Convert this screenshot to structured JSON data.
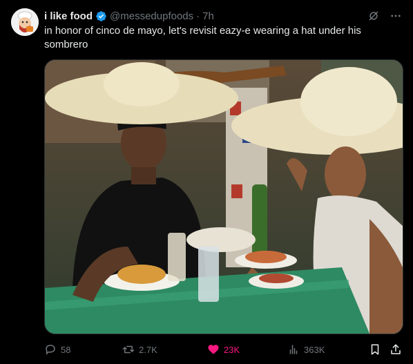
{
  "tweet": {
    "display_name": "i like food",
    "handle": "@messedupfoods",
    "separator": "·",
    "timestamp": "7h",
    "text": "in honor of cinco de mayo, let's revisit eazy-e wearing a hat under his sombrero",
    "verified": true,
    "media": {
      "type": "photo",
      "alt": ""
    }
  },
  "actions": {
    "replies": "58",
    "reposts": "2.7K",
    "likes": "23K",
    "views": "363K"
  },
  "colors": {
    "background": "#000000",
    "text": "#e7e9ea",
    "muted": "#71767b",
    "verified": "#1d9bf0",
    "like": "#f91880"
  },
  "icons": [
    "grok-icon",
    "more-icon",
    "reply-icon",
    "repost-icon",
    "heart-icon",
    "views-icon",
    "bookmark-icon",
    "share-icon",
    "verified-badge-icon"
  ]
}
